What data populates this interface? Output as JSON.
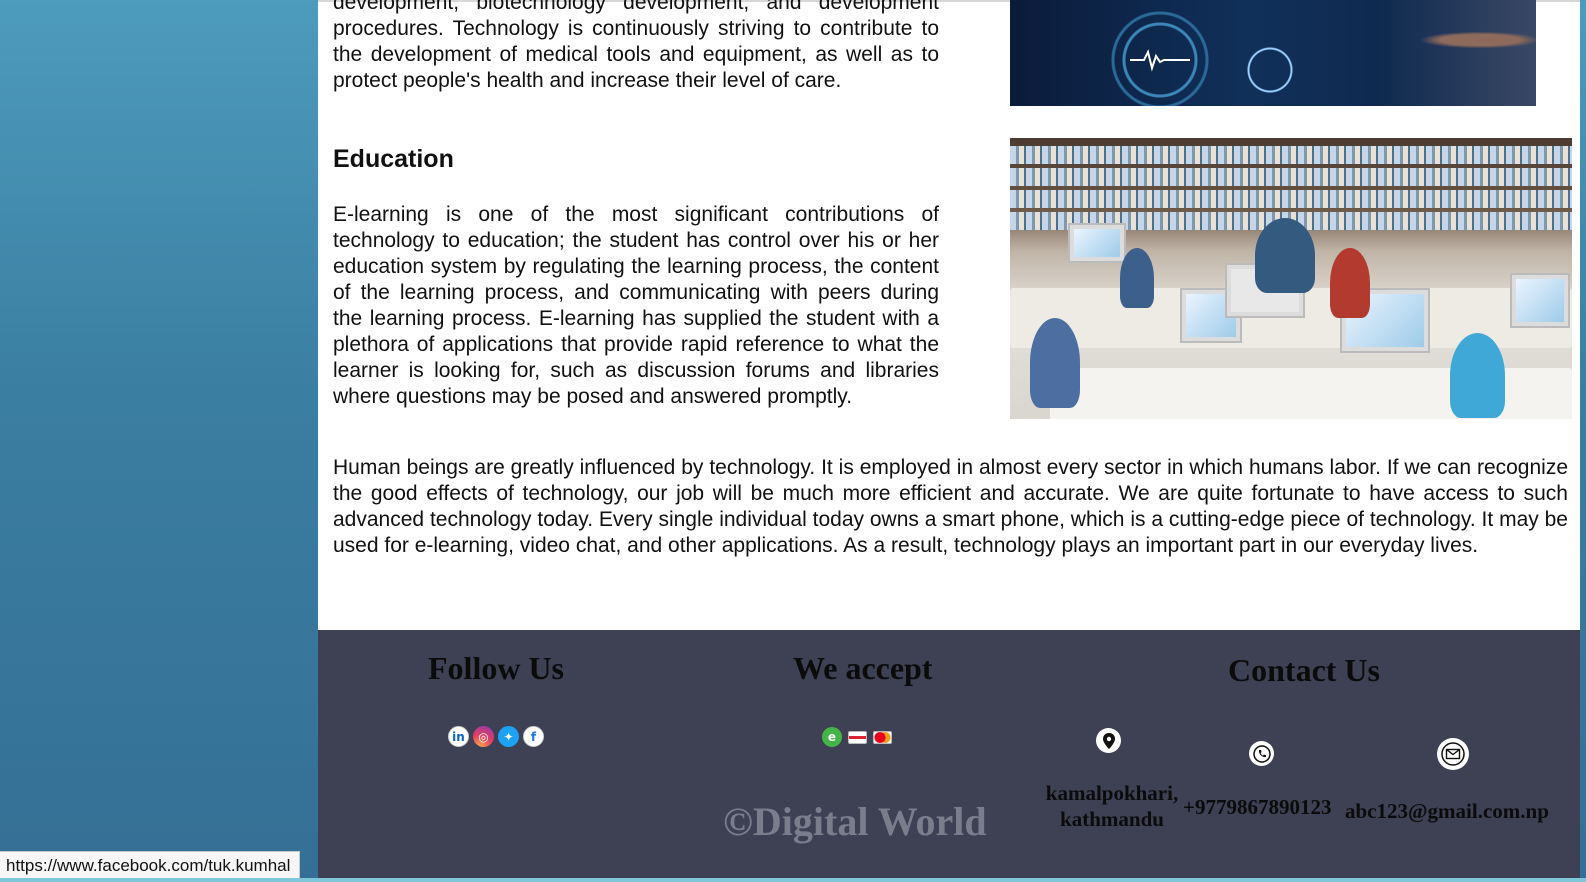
{
  "health": {
    "paragraph": "development, biotechnology development, and development procedures. Technology is continuously striving to contribute to the development of medical tools and equipment, as well as to protect people's health and increase their level of care."
  },
  "education": {
    "heading": "Education",
    "paragraph": "E-learning is one of the most significant contributions of technology to education; the student has control over his or her education system by regulating the learning process, the content of the learning process, and communicating with peers during the learning process. E-learning has supplied the student with a plethora of applications that provide rapid reference to what the learner is looking for, such as discussion forums and libraries where questions may be posed and answered promptly."
  },
  "summary": {
    "paragraph": "Human beings are greatly influenced by technology. It is employed in almost every sector in which humans labor. If we can recognize the good effects of technology, our job will be much more efficient and accurate. We are quite fortunate to have access to such advanced technology today. Every single individual today owns a smart phone, which is a cutting-edge piece of technology. It may be used for e-learning, video chat, and other applications. As a result, technology plays an important part in our everyday lives."
  },
  "footer": {
    "follow_title": "Follow Us",
    "follow_icons": [
      "linkedin-icon",
      "instagram-icon",
      "twitter-icon",
      "facebook-icon"
    ],
    "accept_title": "We accept",
    "payment_icons": [
      "esewa-icon",
      "visa-card-icon",
      "mastercard-icon"
    ],
    "contact_title": "Contact Us",
    "copyright": "©Digital World",
    "address": "kamalpokhari, kathmandu",
    "address_line1": "kamalpokhari,",
    "address_line2": "kathmandu",
    "phone": "+9779867890123",
    "email": "abc123@gmail.com.np"
  },
  "status_bar": {
    "url": "https://www.facebook.com/tuk.kumhal"
  },
  "colors": {
    "background_gradient_top": "#4d9bbd",
    "background_gradient_bottom": "#356f95",
    "footer_bg": "#3e4054",
    "copyright_text": "#7b7d8c"
  }
}
